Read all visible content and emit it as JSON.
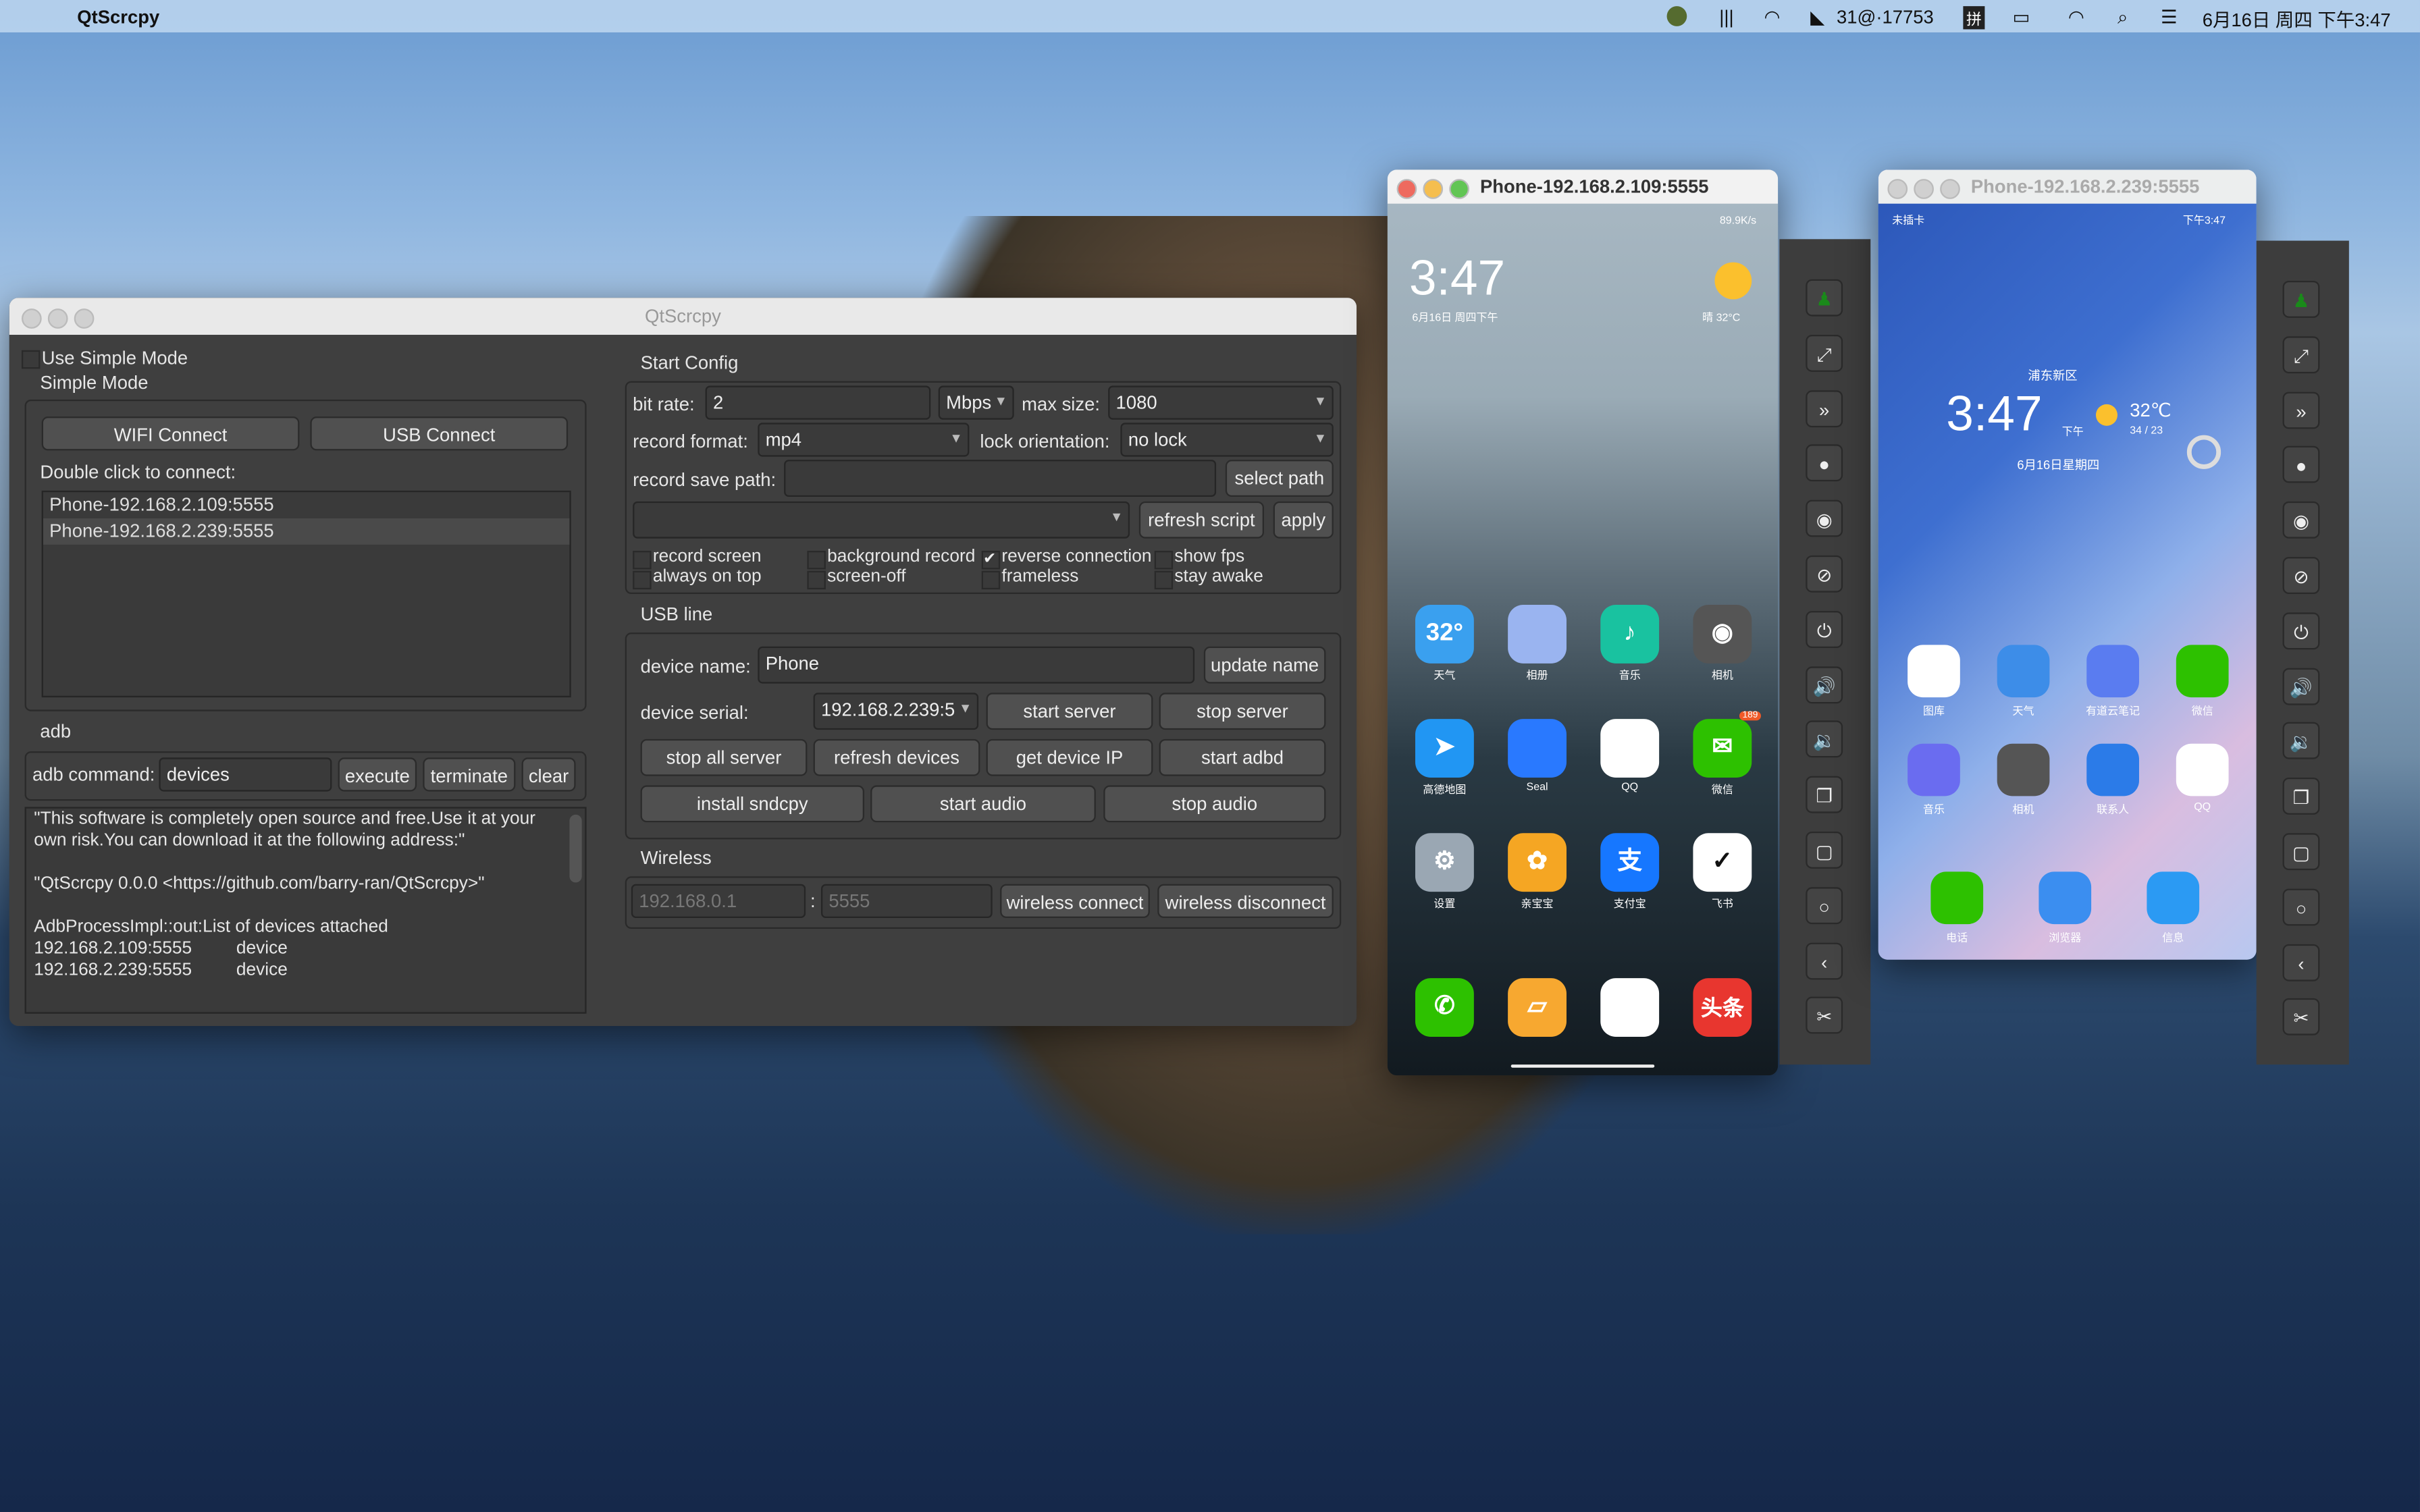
{
  "menubar": {
    "app_name": "QtScrcpy",
    "status_text": "31@·17753",
    "ime": "拼",
    "datetime": "6月16日 周四 下午3:47"
  },
  "main": {
    "title": "QtScrcpy",
    "use_simple_mode": "Use Simple Mode",
    "simple_mode": "Simple Mode",
    "wifi_connect": "WIFI Connect",
    "usb_connect": "USB Connect",
    "double_click": "Double click to connect:",
    "devices": [
      "Phone-192.168.2.109:5555",
      "Phone-192.168.2.239:5555"
    ],
    "adb_title": "adb",
    "adb_command_label": "adb command:",
    "adb_command_value": "devices",
    "execute": "execute",
    "terminate": "terminate",
    "clear": "clear",
    "output": [
      "\"This software is completely open source and free.Use it at your",
      "own risk.You can download it at the following address:\"",
      "",
      "\"QtScrcpy 0.0.0 <https://github.com/barry-ran/QtScrcpy>\"",
      "",
      "AdbProcessImpl::out:List of devices attached",
      "192.168.2.109:5555         device",
      "192.168.2.239:5555         device"
    ],
    "start_config": {
      "title": "Start Config",
      "bit_rate_label": "bit rate:",
      "bit_rate": "2",
      "unit": "Mbps",
      "max_size_label": "max size:",
      "max_size": "1080",
      "record_format_label": "record format:",
      "record_format": "mp4",
      "lock_orientation_label": "lock orientation:",
      "lock_orientation": "no lock",
      "record_save_path_label": "record save path:",
      "record_save_path": "",
      "select_path": "select path",
      "script": "",
      "refresh_script": "refresh script",
      "apply": "apply",
      "checks": [
        {
          "label": "record screen",
          "checked": false
        },
        {
          "label": "background record",
          "checked": false
        },
        {
          "label": "reverse connection",
          "checked": true
        },
        {
          "label": "show fps",
          "checked": false
        },
        {
          "label": "always on top",
          "checked": false
        },
        {
          "label": "screen-off",
          "checked": false
        },
        {
          "label": "frameless",
          "checked": false
        },
        {
          "label": "stay awake",
          "checked": false
        }
      ]
    },
    "usb": {
      "title": "USB line",
      "device_name_label": "device name:",
      "device_name": "Phone",
      "update_name": "update name",
      "device_serial_label": "device serial:",
      "device_serial": "192.168.2.239:5",
      "start_server": "start server",
      "stop_server": "stop server",
      "stop_all_server": "stop all server",
      "refresh_devices": "refresh devices",
      "get_device_ip": "get device IP",
      "start_adbd": "start adbd",
      "install_sndcpy": "install sndcpy",
      "start_audio": "start audio",
      "stop_audio": "stop audio"
    },
    "wireless": {
      "title": "Wireless",
      "ip_placeholder": "192.168.0.1",
      "port_placeholder": "5555",
      "sep": ":",
      "connect": "wireless connect",
      "disconnect": "wireless disconnect"
    }
  },
  "phone1": {
    "title": "Phone-192.168.2.109:5555",
    "status": "89.9K/s",
    "time": "3:47",
    "date": "6月16日 周四下午",
    "weather": "晴  32°C",
    "apps": [
      "天气",
      "相册",
      "音乐",
      "相机",
      "高德地图",
      "Seal",
      "QQ",
      "微信",
      "设置",
      "亲宝宝",
      "支付宝",
      "飞书"
    ],
    "wechat_badge": "189",
    "weather_icon_text": "32°",
    "dock": [
      "phone",
      "notes",
      "chrome-beta",
      "头条"
    ]
  },
  "phone2": {
    "title": "Phone-192.168.2.239:5555",
    "status_left": "未插卡",
    "status_right": "下午3:47",
    "location": "浦东新区",
    "time": "3:47",
    "ampm": "下午",
    "temp": "32℃",
    "range": "34 / 23",
    "date": "6月16日星期四",
    "apps": [
      "图库",
      "天气",
      "有道云笔记",
      "微信",
      "音乐",
      "相机",
      "联系人",
      "QQ"
    ],
    "dock": [
      "电话",
      "浏览器",
      "信息"
    ]
  },
  "toolbar": [
    "switch-app",
    "fullscreen",
    "collapse",
    "screen-off",
    "show-touches",
    "hide-touches",
    "power",
    "volume-up",
    "volume-down",
    "copy",
    "app-switch",
    "home",
    "back",
    "screenshot"
  ],
  "colors": {
    "accent_green": "#1a8a1a",
    "window_bg": "#3f3f3f"
  }
}
